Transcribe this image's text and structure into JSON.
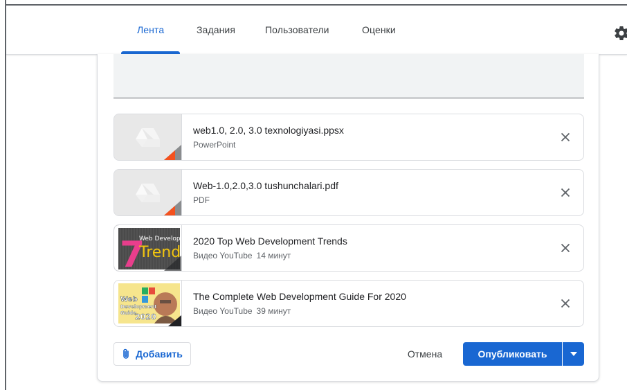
{
  "nav": {
    "tabs": [
      {
        "label": "Лента",
        "active": true
      },
      {
        "label": "Задания",
        "active": false
      },
      {
        "label": "Пользователи",
        "active": false
      },
      {
        "label": "Оценки",
        "active": false
      }
    ],
    "settings_icon": "gear-icon"
  },
  "attachments": [
    {
      "title": "web1.0, 2.0, 3.0 texnologiyasi.ppsx",
      "type": "PowerPoint",
      "duration": "",
      "thumb": "drive-icon"
    },
    {
      "title": "Web-1.0,2.0,3.0 tushunchalari.pdf",
      "type": "PDF",
      "duration": "",
      "thumb": "drive-icon"
    },
    {
      "title": "2020 Top Web Development Trends",
      "type": "Видео YouTube",
      "duration": "14 минут",
      "thumb": "video-thumbnail",
      "thumb_text": {
        "number": "7",
        "top": "Web Development",
        "word": "Trends"
      }
    },
    {
      "title": "The Complete Web Development Guide For 2020",
      "type": "Видео YouTube",
      "duration": "39 минут",
      "thumb": "video-thumbnail",
      "thumb_text": {
        "line1": "Web",
        "line2": "Development",
        "line3": "Guide",
        "year": "2020"
      }
    }
  ],
  "actions": {
    "add_label": "Добавить",
    "cancel_label": "Отмена",
    "publish_label": "Опубликовать"
  },
  "colors": {
    "accent": "#1967d2",
    "powerpoint": "#f4511e",
    "pdf": "#f4511e"
  }
}
